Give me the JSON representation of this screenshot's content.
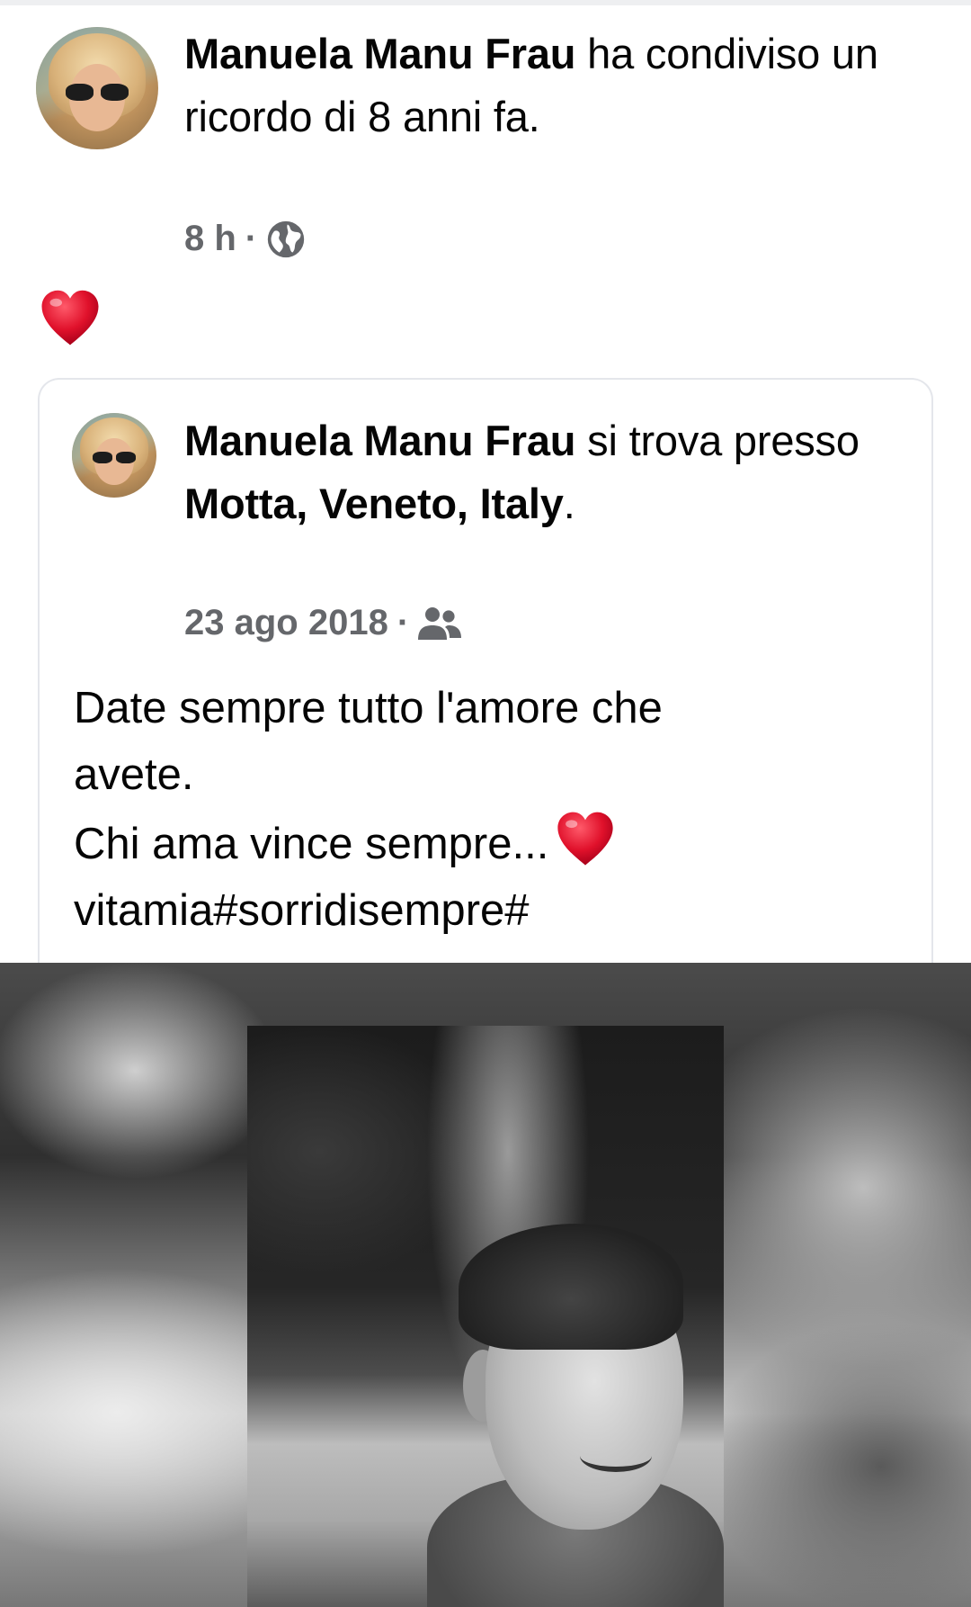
{
  "outer_post": {
    "author": "Manuela Manu Frau",
    "action_text": " ha condiviso un ricordo di 8 anni fa.",
    "time": "8 h",
    "separator": "·",
    "privacy_icon": "globe-icon",
    "reaction_icon": "heart-emoji"
  },
  "shared_post": {
    "author": "Manuela Manu Frau",
    "action_prefix": " si trova presso ",
    "location": "Motta, Veneto, Italy",
    "action_suffix": ".",
    "date": "23 ago 2018",
    "separator": "·",
    "privacy_icon": "friends-icon",
    "text_line1": "Date sempre tutto l'amore che",
    "text_line2": "avete.",
    "text_line3": "Chi ama vince sempre...",
    "text_line4": "vitamia#sorridisempre#",
    "photo_description_icon": "photo"
  },
  "colors": {
    "text_primary": "#050505",
    "text_secondary": "#65676b",
    "heart": "#e0112b",
    "card_border": "#e4e6eb"
  }
}
